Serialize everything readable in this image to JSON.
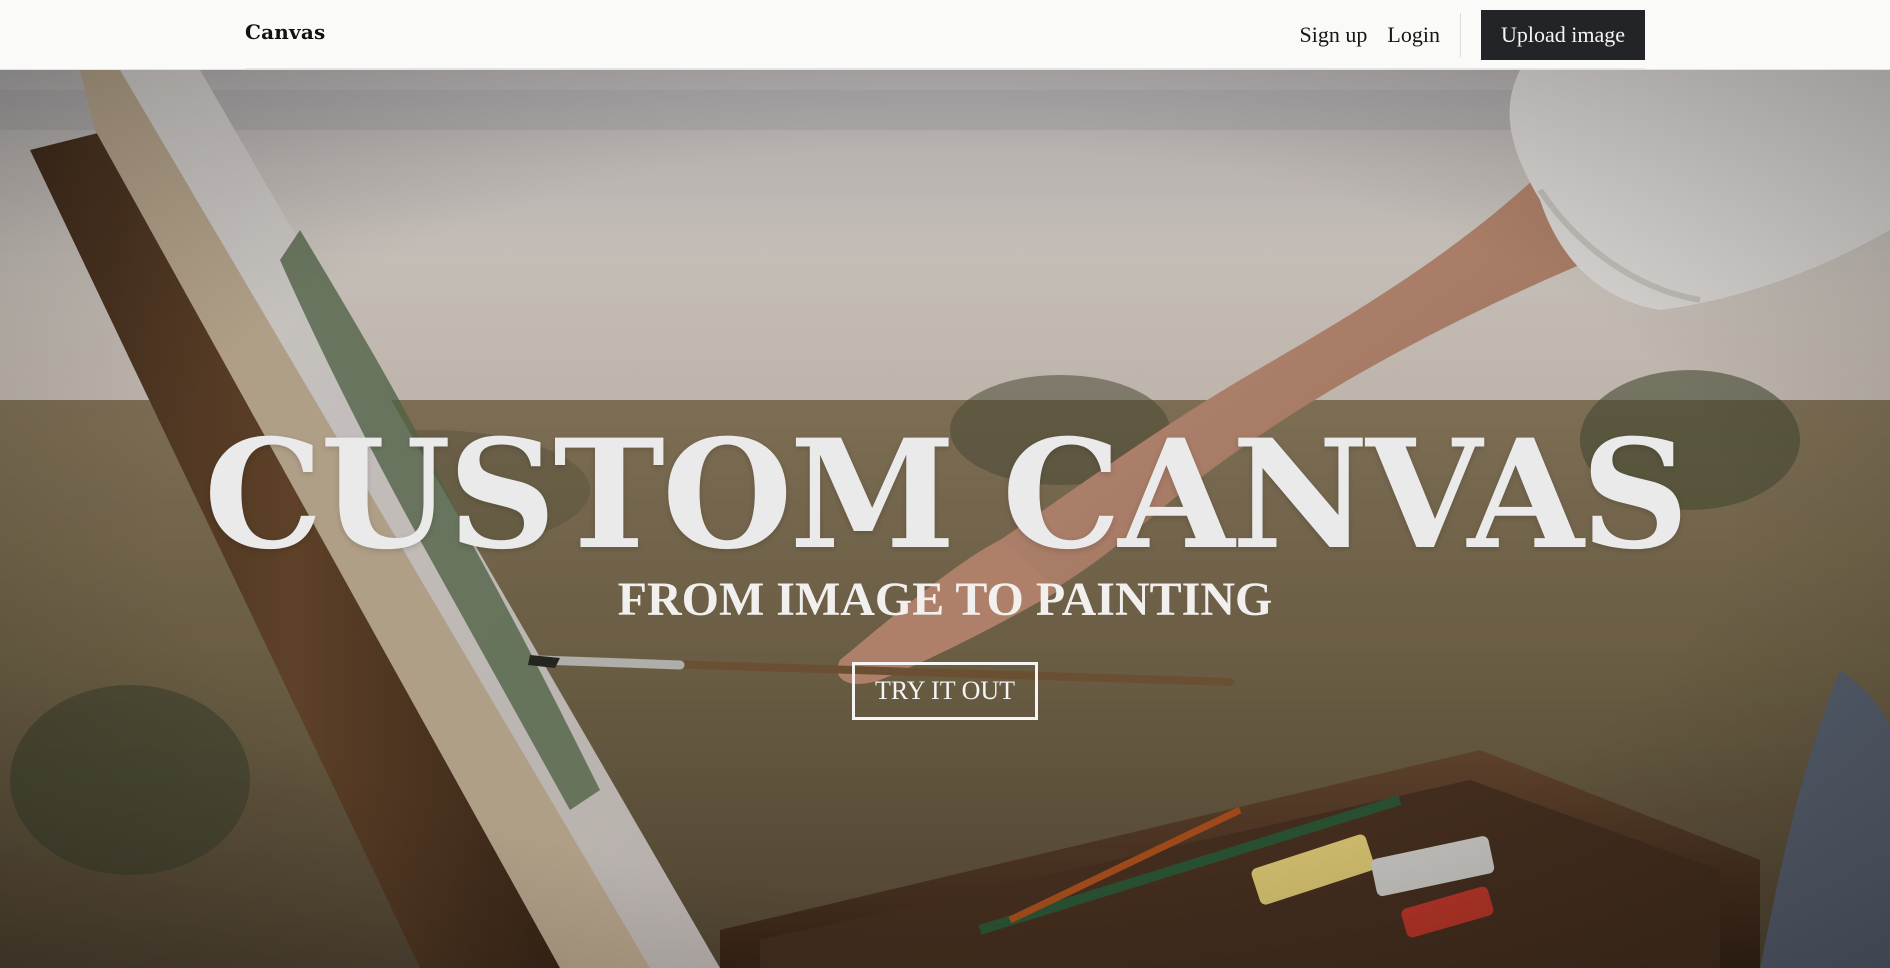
{
  "header": {
    "brand": "Canvas",
    "nav": {
      "signup_label": "Sign up",
      "login_label": "Login",
      "upload_label": "Upload image"
    }
  },
  "hero": {
    "title": "CUSTOM CANVAS",
    "subtitle": "FROM IMAGE TO PAINTING",
    "cta_label": "TRY IT OUT"
  },
  "colors": {
    "text_on_hero": "#ebeaea",
    "upload_button_bg": "#232427",
    "header_bg": "#fafaf8"
  }
}
